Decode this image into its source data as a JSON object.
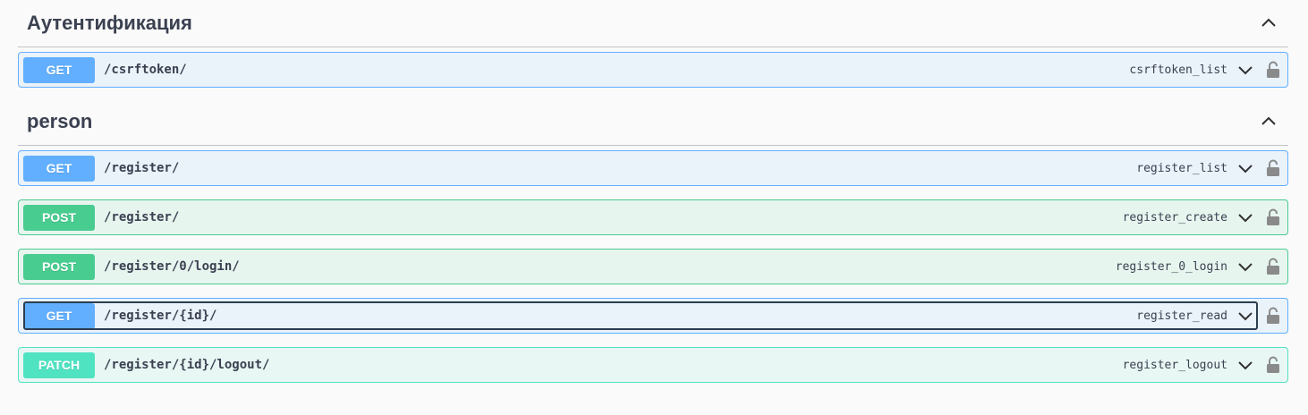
{
  "sections": [
    {
      "title": "Аутентификация",
      "operations": [
        {
          "method": "GET",
          "path": "/csrftoken/",
          "operation_id": "csrftoken_list"
        }
      ]
    },
    {
      "title": "person",
      "operations": [
        {
          "method": "GET",
          "path": "/register/",
          "operation_id": "register_list"
        },
        {
          "method": "POST",
          "path": "/register/",
          "operation_id": "register_create"
        },
        {
          "method": "POST",
          "path": "/register/0/login/",
          "operation_id": "register_0_login"
        },
        {
          "method": "GET",
          "path": "/register/{id}/",
          "operation_id": "register_read"
        },
        {
          "method": "PATCH",
          "path": "/register/{id}/logout/",
          "operation_id": "register_logout"
        }
      ]
    }
  ],
  "icons": {
    "section_toggle": "chevron-up-icon",
    "op_toggle": "chevron-down-icon",
    "auth": "lock-icon"
  },
  "colors": {
    "get": "#61affe",
    "post": "#49cc90",
    "patch": "#50e3c2",
    "lock": "#8a8a8a"
  }
}
